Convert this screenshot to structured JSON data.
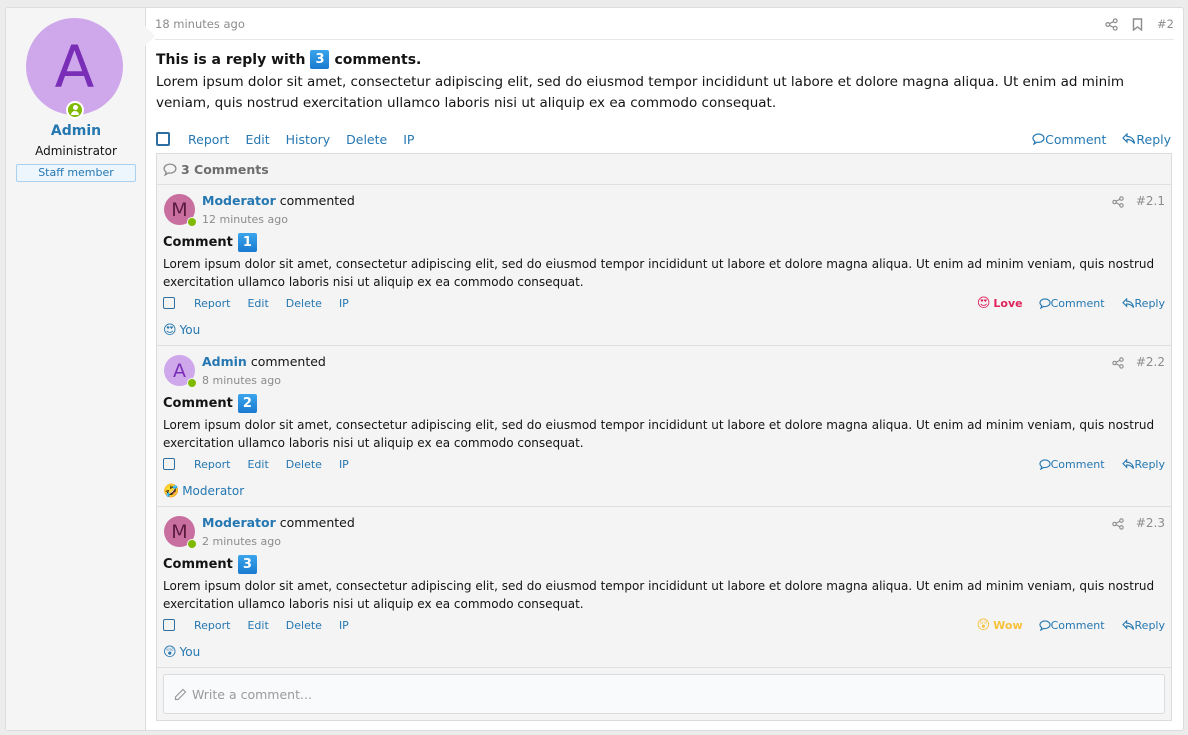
{
  "user": {
    "avatar_letter": "A",
    "name": "Admin",
    "title": "Administrator",
    "badge": "Staff member",
    "online": true
  },
  "post": {
    "time": "18 minutes ago",
    "number": "#2",
    "title_before": "This is a reply with",
    "title_badge": "3",
    "title_after": "comments.",
    "body": "Lorem ipsum dolor sit amet, consectetur adipiscing elit, sed do eiusmod tempor incididunt ut labore et dolore magna aliqua. Ut enim ad minim veniam, quis nostrud exercitation ullamco laboris nisi ut aliquip ex ea commodo consequat.",
    "actions": [
      "Report",
      "Edit",
      "History",
      "Delete",
      "IP"
    ],
    "comment_label": "Comment",
    "reply_label": "Reply",
    "icons": [
      "share-icon",
      "bookmark-icon"
    ]
  },
  "comments_section": {
    "header": "3 Comments",
    "commented_word": "commented",
    "action_labels": [
      "Report",
      "Edit",
      "Delete",
      "IP"
    ],
    "comment_label": "Comment",
    "reply_label": "Reply",
    "write_placeholder": "Write a comment...",
    "items": [
      {
        "author": "Moderator",
        "avatar_letter": "M",
        "avatar_bg": "#c86f9f",
        "avatar_fg": "#5a1a3e",
        "time": "12 minutes ago",
        "number": "#2.1",
        "title": "Comment",
        "badge": "1",
        "body": "Lorem ipsum dolor sit amet, consectetur adipiscing elit, sed do eiusmod tempor incididunt ut labore et dolore magna aliqua. Ut enim ad minim veniam, quis nostrud exercitation ullamco laboris nisi ut aliquip ex ea commodo consequat.",
        "my_reaction": {
          "emoji": "😍",
          "label": "Love",
          "color": "#e0245e"
        },
        "reactions_emoji": "😍",
        "reactions_by": "You"
      },
      {
        "author": "Admin",
        "avatar_letter": "A",
        "avatar_bg": "#cfa8ec",
        "avatar_fg": "#7a2eb7",
        "time": "8 minutes ago",
        "number": "#2.2",
        "title": "Comment",
        "badge": "2",
        "body": "Lorem ipsum dolor sit amet, consectetur adipiscing elit, sed do eiusmod tempor incididunt ut labore et dolore magna aliqua. Ut enim ad minim veniam, quis nostrud exercitation ullamco laboris nisi ut aliquip ex ea commodo consequat.",
        "my_reaction": null,
        "reactions_emoji": "🤣",
        "reactions_by": "Moderator"
      },
      {
        "author": "Moderator",
        "avatar_letter": "M",
        "avatar_bg": "#c86f9f",
        "avatar_fg": "#5a1a3e",
        "time": "2 minutes ago",
        "number": "#2.3",
        "title": "Comment",
        "badge": "3",
        "body": "Lorem ipsum dolor sit amet, consectetur adipiscing elit, sed do eiusmod tempor incididunt ut labore et dolore magna aliqua. Ut enim ad minim veniam, quis nostrud exercitation ullamco laboris nisi ut aliquip ex ea commodo consequat.",
        "my_reaction": {
          "emoji": "😲",
          "label": "Wow",
          "color": "#f7c13a"
        },
        "reactions_emoji": "😲",
        "reactions_by": "You"
      }
    ]
  },
  "colors": {
    "link": "#2577b1",
    "online": "#7fb900",
    "badge_blue": "#1a7ad0"
  }
}
